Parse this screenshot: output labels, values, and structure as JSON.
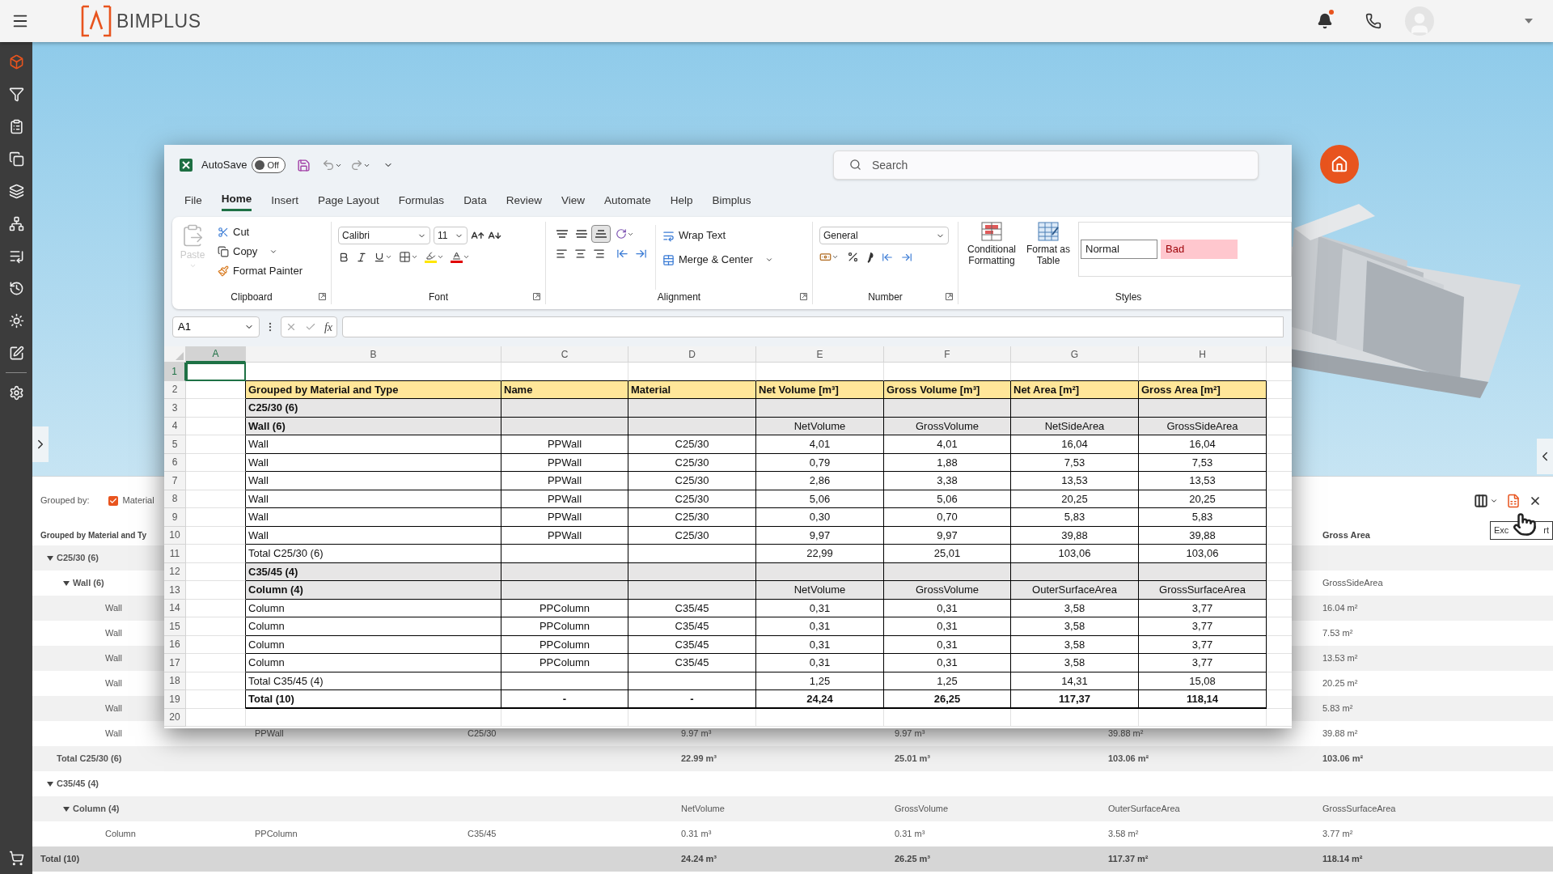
{
  "top_bar": {
    "app_name": "BIMPLUS",
    "notifications": {
      "unread": true
    }
  },
  "sidebar": {
    "items": [
      {
        "selected": true
      },
      {
        "selected": false
      },
      {
        "selected": false
      },
      {
        "selected": false
      },
      {
        "selected": false
      },
      {
        "selected": false
      },
      {
        "selected": false
      },
      {
        "selected": false
      },
      {
        "selected": false
      },
      {
        "selected": false
      },
      {
        "selected": false
      }
    ]
  },
  "excel": {
    "title_bar": {
      "autosave": {
        "label": "AutoSave",
        "on": false,
        "state_label": "Off"
      },
      "search": {
        "placeholder": "Search"
      }
    },
    "tabs": [
      {
        "label": "File",
        "selected": false
      },
      {
        "label": "Home",
        "selected": true
      },
      {
        "label": "Insert",
        "selected": false
      },
      {
        "label": "Page Layout",
        "selected": false
      },
      {
        "label": "Formulas",
        "selected": false
      },
      {
        "label": "Data",
        "selected": false
      },
      {
        "label": "Review",
        "selected": false
      },
      {
        "label": "View",
        "selected": false
      },
      {
        "label": "Automate",
        "selected": false
      },
      {
        "label": "Help",
        "selected": false
      },
      {
        "label": "Bimplus",
        "selected": false
      }
    ],
    "ribbon": {
      "clipboard": {
        "label": "Clipboard",
        "paste": {
          "label": "Paste",
          "disabled": true
        },
        "cut": "Cut",
        "copy": "Copy",
        "format_painter": "Format Painter"
      },
      "font": {
        "label": "Font",
        "font_name": "Calibri",
        "font_size": "11"
      },
      "alignment": {
        "label": "Alignment",
        "vertical": [
          {
            "selected": false
          },
          {
            "selected": false
          },
          {
            "selected": true
          }
        ],
        "wrap_text": "Wrap Text",
        "merge_center": "Merge & Center"
      },
      "number": {
        "label": "Number",
        "format": "General"
      },
      "styles": {
        "label": "Styles",
        "conditional_formatting": "Conditional Formatting",
        "format_as_table": "Format as Table",
        "cell_styles": [
          {
            "label": "Normal",
            "color": "#ffffff"
          },
          {
            "label": "Bad",
            "color": "#ffc7ce"
          }
        ]
      }
    },
    "formula_bar": {
      "name_box": "A1",
      "function_label": "fx"
    },
    "sheet": {
      "columns": [
        {
          "label": "A",
          "selected": true
        },
        {
          "label": "B",
          "selected": false
        },
        {
          "label": "C",
          "selected": false
        },
        {
          "label": "D",
          "selected": false
        },
        {
          "label": "E",
          "selected": false
        },
        {
          "label": "F",
          "selected": false
        },
        {
          "label": "G",
          "selected": false
        },
        {
          "label": "H",
          "selected": false
        }
      ],
      "rows": [
        {
          "number": "1",
          "selected": true,
          "kind": "blank"
        },
        {
          "number": "2",
          "selected": false,
          "kind": "header",
          "cells": {
            "B": "Grouped by Material and Type",
            "C": "Name",
            "D": "Material",
            "E": "Net Volume [m³]",
            "F": "Gross Volume [m³]",
            "G": "Net Area [m²]",
            "H": "Gross Area [m²]"
          }
        },
        {
          "number": "3",
          "selected": false,
          "kind": "group",
          "cells": {
            "B": "C25/30 (6)"
          }
        },
        {
          "number": "4",
          "selected": false,
          "kind": "subgroup",
          "cells": {
            "B": "Wall (6)",
            "E": "NetVolume",
            "F": "GrossVolume",
            "G": "NetSideArea",
            "H": "GrossSideArea"
          }
        },
        {
          "number": "5",
          "selected": false,
          "kind": "item",
          "cells": {
            "B": "Wall",
            "C": "PPWall",
            "D": "C25/30",
            "E": "4,01",
            "F": "4,01",
            "G": "16,04",
            "H": "16,04"
          }
        },
        {
          "number": "6",
          "selected": false,
          "kind": "item",
          "cells": {
            "B": "Wall",
            "C": "PPWall",
            "D": "C25/30",
            "E": "0,79",
            "F": "1,88",
            "G": "7,53",
            "H": "7,53"
          }
        },
        {
          "number": "7",
          "selected": false,
          "kind": "item",
          "cells": {
            "B": "Wall",
            "C": "PPWall",
            "D": "C25/30",
            "E": "2,86",
            "F": "3,38",
            "G": "13,53",
            "H": "13,53"
          }
        },
        {
          "number": "8",
          "selected": false,
          "kind": "item",
          "cells": {
            "B": "Wall",
            "C": "PPWall",
            "D": "C25/30",
            "E": "5,06",
            "F": "5,06",
            "G": "20,25",
            "H": "20,25"
          }
        },
        {
          "number": "9",
          "selected": false,
          "kind": "item",
          "cells": {
            "B": "Wall",
            "C": "PPWall",
            "D": "C25/30",
            "E": "0,30",
            "F": "0,70",
            "G": "5,83",
            "H": "5,83"
          }
        },
        {
          "number": "10",
          "selected": false,
          "kind": "item",
          "cells": {
            "B": "Wall",
            "C": "PPWall",
            "D": "C25/30",
            "E": "9,97",
            "F": "9,97",
            "G": "39,88",
            "H": "39,88"
          }
        },
        {
          "number": "11",
          "selected": false,
          "kind": "total",
          "cells": {
            "B": "Total C25/30 (6)",
            "E": "22,99",
            "F": "25,01",
            "G": "103,06",
            "H": "103,06"
          }
        },
        {
          "number": "12",
          "selected": false,
          "kind": "group",
          "cells": {
            "B": "C35/45 (4)"
          }
        },
        {
          "number": "13",
          "selected": false,
          "kind": "subgroup",
          "cells": {
            "B": "Column (4)",
            "E": "NetVolume",
            "F": "GrossVolume",
            "G": "OuterSurfaceArea",
            "H": "GrossSurfaceArea"
          }
        },
        {
          "number": "14",
          "selected": false,
          "kind": "item",
          "cells": {
            "B": "Column",
            "C": "PPColumn",
            "D": "C35/45",
            "E": "0,31",
            "F": "0,31",
            "G": "3,58",
            "H": "3,77"
          }
        },
        {
          "number": "15",
          "selected": false,
          "kind": "item",
          "cells": {
            "B": "Column",
            "C": "PPColumn",
            "D": "C35/45",
            "E": "0,31",
            "F": "0,31",
            "G": "3,58",
            "H": "3,77"
          }
        },
        {
          "number": "16",
          "selected": false,
          "kind": "item",
          "cells": {
            "B": "Column",
            "C": "PPColumn",
            "D": "C35/45",
            "E": "0,31",
            "F": "0,31",
            "G": "3,58",
            "H": "3,77"
          }
        },
        {
          "number": "17",
          "selected": false,
          "kind": "item",
          "cells": {
            "B": "Column",
            "C": "PPColumn",
            "D": "C35/45",
            "E": "0,31",
            "F": "0,31",
            "G": "3,58",
            "H": "3,77"
          }
        },
        {
          "number": "18",
          "selected": false,
          "kind": "total",
          "cells": {
            "B": "Total C35/45 (4)",
            "E": "1,25",
            "F": "1,25",
            "G": "14,31",
            "H": "15,08"
          }
        },
        {
          "number": "19",
          "selected": false,
          "kind": "grandtotal",
          "cells": {
            "B": "Total (10)",
            "C": "-",
            "D": "-",
            "E": "24,24",
            "F": "26,25",
            "G": "117,37",
            "H": "118,14"
          }
        },
        {
          "number": "20",
          "selected": false,
          "kind": "blank"
        }
      ]
    }
  },
  "results": {
    "grouped_by": {
      "label": "Grouped by:",
      "options": [
        {
          "label": "Material",
          "checked": true
        }
      ]
    },
    "tooltip": {
      "parts": [
        "Exc",
        "rt"
      ]
    },
    "columns": {
      "group": "Grouped by Material and Ty",
      "gross_area": "Gross Area"
    },
    "groups": [
      {
        "label": "C25/30 (6)",
        "expanded": true,
        "children": [
          {
            "label": "Wall (6)",
            "expanded": true,
            "cells": {
              "gross_area": "GrossSideArea"
            },
            "children": [
              {
                "label": "Wall",
                "cells": {
                  "gross_area": "16.04 m²"
                }
              },
              {
                "label": "Wall",
                "cells": {
                  "gross_area": "7.53 m²"
                }
              },
              {
                "label": "Wall",
                "cells": {
                  "gross_area": "13.53 m²"
                }
              },
              {
                "label": "Wall",
                "cells": {
                  "gross_area": "20.25 m²"
                }
              },
              {
                "label": "Wall",
                "cells": {
                  "gross_area": "5.83 m²"
                }
              },
              {
                "label": "Wall",
                "cells": {
                  "name": "PPWall",
                  "material": "C25/30",
                  "net_volume": "9.97 m³",
                  "gross_volume": "9.97 m³",
                  "net_area": "39.88 m²",
                  "gross_area": "39.88 m²"
                }
              }
            ]
          }
        ],
        "total": {
          "label": "Total C25/30 (6)",
          "cells": {
            "net_volume": "22.99 m³",
            "gross_volume": "25.01 m³",
            "net_area": "103.06 m²",
            "gross_area": "103.06 m²"
          }
        }
      },
      {
        "label": "C35/45 (4)",
        "expanded": true,
        "children": [
          {
            "label": "Column (4)",
            "expanded": true,
            "cells": {
              "net_volume": "NetVolume",
              "gross_volume": "GrossVolume",
              "net_area": "OuterSurfaceArea",
              "gross_area": "GrossSurfaceArea"
            },
            "children": [
              {
                "label": "Column",
                "cells": {
                  "name": "PPColumn",
                  "material": "C35/45",
                  "net_volume": "0.31 m³",
                  "gross_volume": "0.31 m³",
                  "net_area": "3.58 m²",
                  "gross_area": "3.77 m²"
                }
              }
            ]
          }
        ]
      }
    ],
    "grand_total": {
      "label": "Total (10)",
      "cells": {
        "net_volume": "24.24 m³",
        "gross_volume": "26.25 m³",
        "net_area": "117.37 m²",
        "gross_area": "118.14 m²"
      }
    }
  }
}
